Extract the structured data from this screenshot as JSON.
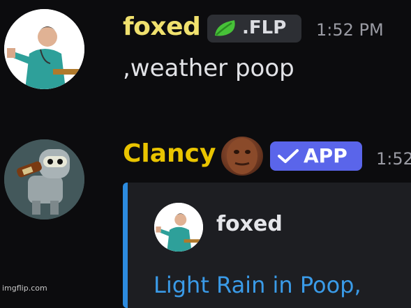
{
  "messages": [
    {
      "username": "foxed",
      "tag": ".FLP",
      "tag_icon": "leaf-icon",
      "timestamp": "1:52 PM",
      "content": ",weather poop"
    },
    {
      "username": "Clancy",
      "badge": "APP",
      "timestamp": "1:52",
      "embed": {
        "author": "foxed",
        "title": "Light Rain in Poop,",
        "accent_color": "#2c8bdf"
      }
    }
  ],
  "watermark": "imgflip.com",
  "colors": {
    "background": "#0c0c0e",
    "username_foxed": "#f0e16e",
    "username_clancy": "#e9c400",
    "app_badge": "#5a65ea",
    "link": "#3a9be8"
  }
}
